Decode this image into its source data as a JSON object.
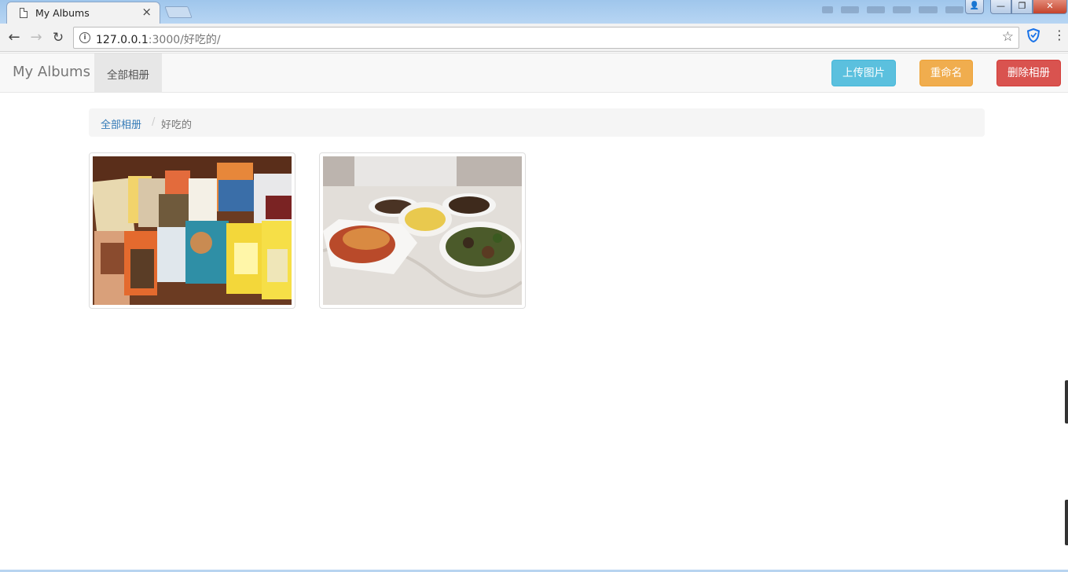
{
  "browser": {
    "tab_title": "My Albums",
    "tab_close": "×",
    "url_host": "127.0.0.1",
    "url_rest": ":3000/好吃的/",
    "info_glyph": "i",
    "back_glyph": "←",
    "forward_glyph": "→",
    "reload_glyph": "↻",
    "star_glyph": "☆",
    "menu_glyph": "⋮",
    "window_controls": {
      "minimize": "—",
      "restore": "❐",
      "close": "✕",
      "user": "👤"
    }
  },
  "navbar": {
    "brand": "My Albums",
    "nav_item": "全部相册",
    "buttons": {
      "upload": "上传图片",
      "rename": "重命名",
      "delete": "删除相册"
    }
  },
  "breadcrumb": {
    "root": "全部相册",
    "separator": "/",
    "current": "好吃的"
  },
  "photos": [
    {
      "name": "snack-packages-photo"
    },
    {
      "name": "dinner-table-photo"
    }
  ],
  "colors": {
    "info": "#5bc0de",
    "warning": "#f0ad4e",
    "danger": "#d9534f",
    "link": "#337ab7"
  }
}
